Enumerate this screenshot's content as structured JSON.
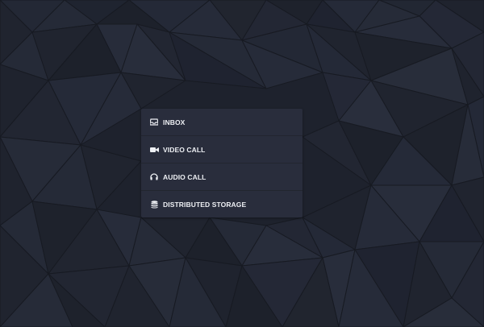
{
  "menu": {
    "items": [
      {
        "label": "INBOX",
        "icon": "inbox-icon"
      },
      {
        "label": "VIDEO CALL",
        "icon": "video-camera-icon"
      },
      {
        "label": "AUDIO CALL",
        "icon": "headphones-icon"
      },
      {
        "label": "DISTRIBUTED STORAGE",
        "icon": "database-icon"
      }
    ]
  },
  "colors": {
    "background": "#1e222d",
    "menu_background": "#292d3c",
    "text": "#eef0f4"
  }
}
